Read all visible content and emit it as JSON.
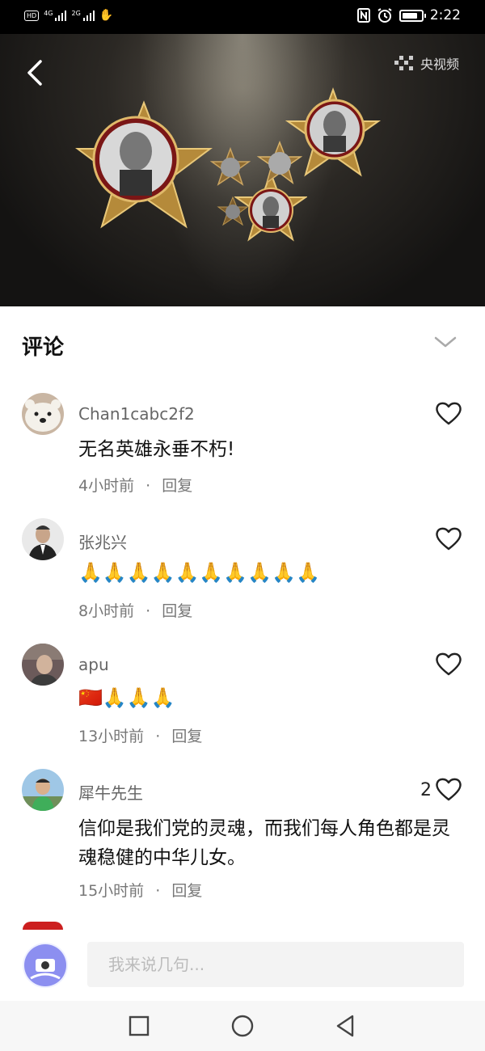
{
  "status_bar": {
    "hd_label": "HD",
    "sim1_label": "4G",
    "sim2_label": "2G",
    "time": "2:22",
    "battery_level": 0.8
  },
  "video": {
    "brand_label": "央视频"
  },
  "comments": {
    "title": "评论",
    "items": [
      {
        "user": "Chan1cabc2f2",
        "text": "无名英雄永垂不朽!",
        "time": "4小时前",
        "reply": "回复",
        "likes": ""
      },
      {
        "user": "张兆兴",
        "text": "🙏🙏🙏🙏🙏🙏🙏🙏🙏🙏",
        "time": "8小时前",
        "reply": "回复",
        "likes": ""
      },
      {
        "user": "apu",
        "text": "🇨🇳🙏🙏🙏",
        "time": "13小时前",
        "reply": "回复",
        "likes": ""
      },
      {
        "user": "犀牛先生",
        "text": "信仰是我们党的灵魂，而我们每人角色都是灵魂稳健的中华儿女。",
        "time": "15小时前",
        "reply": "回复",
        "likes": "2"
      }
    ],
    "separator": "·"
  },
  "input": {
    "placeholder": "我来说几句..."
  },
  "colors": {
    "accent_red": "#cc1f1f",
    "status_bg": "#000000",
    "text_secondary": "#777777"
  }
}
